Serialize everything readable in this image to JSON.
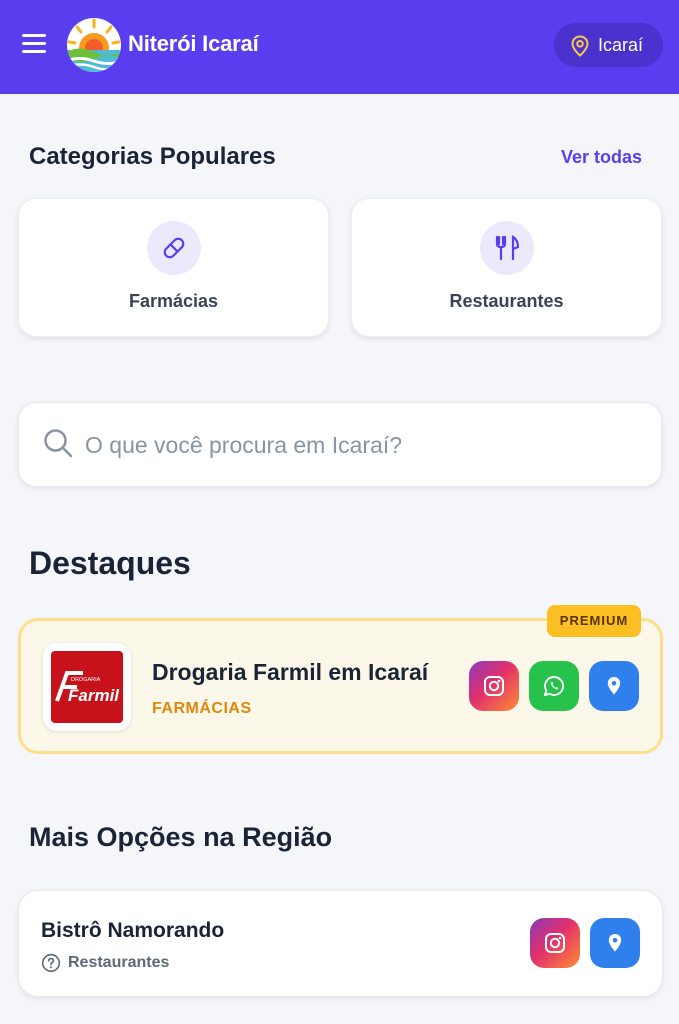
{
  "header": {
    "brand": "Niterói Icaraí",
    "location": "Icaraí"
  },
  "categories": {
    "title": "Categorias Populares",
    "see_all": "Ver todas",
    "items": [
      {
        "label": "Farmácias",
        "icon": "pill-icon"
      },
      {
        "label": "Restaurantes",
        "icon": "utensils-icon"
      }
    ]
  },
  "search": {
    "placeholder": "O que você procura em Icaraí?",
    "value": ""
  },
  "highlights": {
    "title": "Destaques",
    "items": [
      {
        "badge": "PREMIUM",
        "name": "Drogaria Farmil em Icaraí",
        "category": "FARMÁCIAS",
        "logo_text": "Farmil",
        "logo_subtext": "DROGARIA",
        "actions": [
          "instagram-icon",
          "whatsapp-icon",
          "map-pin-icon"
        ]
      }
    ]
  },
  "more": {
    "title": "Mais Opções na Região",
    "items": [
      {
        "name": "Bistrô Namorando",
        "category": "Restaurantes",
        "actions": [
          "instagram-icon",
          "map-pin-icon"
        ]
      }
    ]
  },
  "colors": {
    "primary": "#5b3df0",
    "premium": "#fbbf24",
    "category_accent": "#e2860b",
    "whatsapp": "#27c24c",
    "maps": "#2f80ed"
  }
}
